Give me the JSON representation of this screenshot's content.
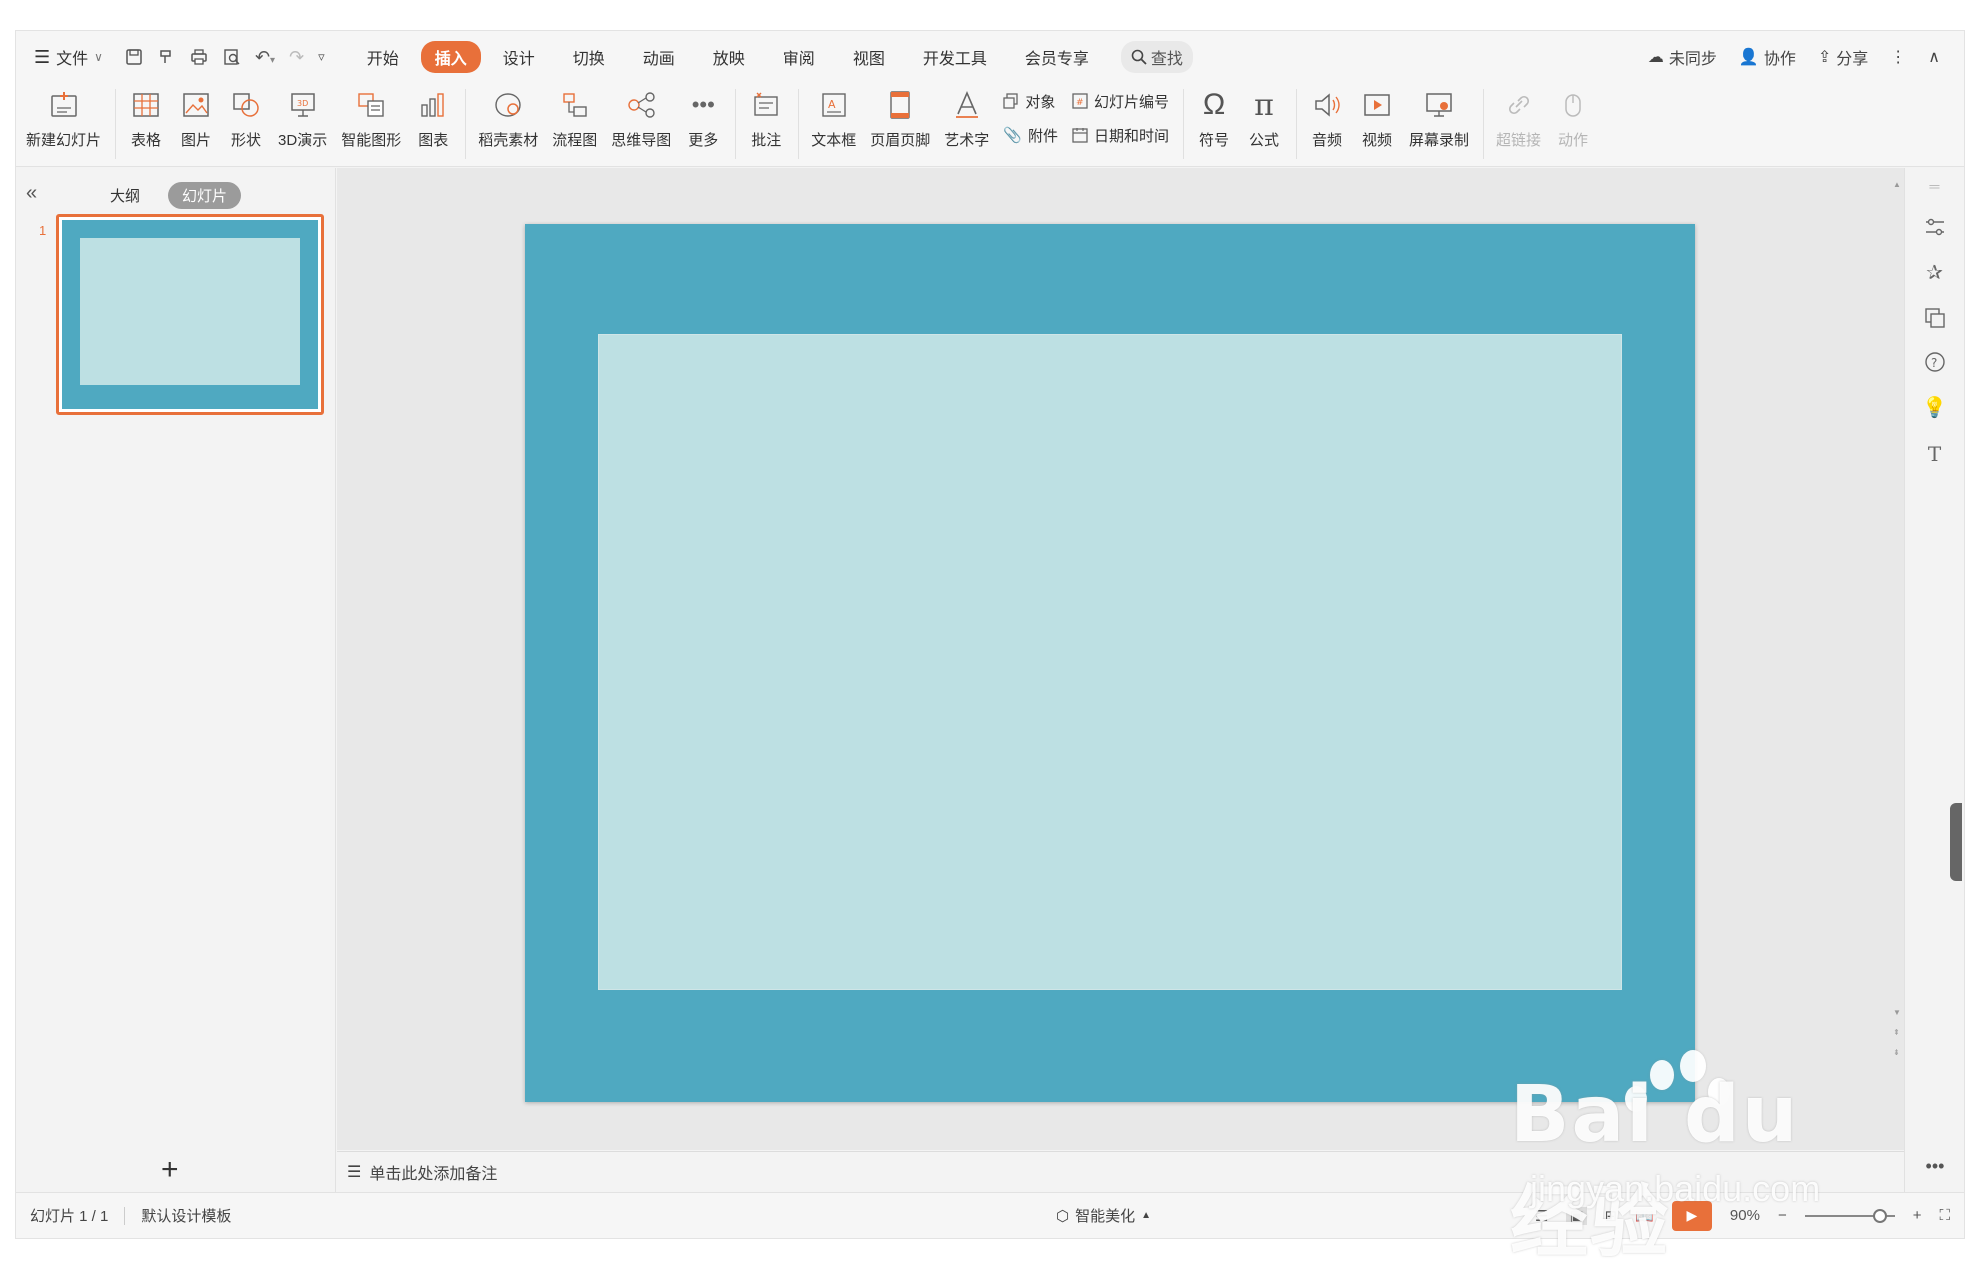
{
  "menubar": {
    "file_label": "文件",
    "tabs": [
      {
        "label": "开始"
      },
      {
        "label": "插入"
      },
      {
        "label": "设计"
      },
      {
        "label": "切换"
      },
      {
        "label": "动画"
      },
      {
        "label": "放映"
      },
      {
        "label": "审阅"
      },
      {
        "label": "视图"
      },
      {
        "label": "开发工具"
      },
      {
        "label": "会员专享"
      }
    ],
    "active_tab": "插入",
    "search_label": "查找",
    "sync_label": "未同步",
    "collab_label": "协作",
    "share_label": "分享"
  },
  "ribbon": {
    "new_slide": "新建幻灯片",
    "table": "表格",
    "picture": "图片",
    "shape": "形状",
    "demo3d": "3D演示",
    "smartart": "智能图形",
    "chart": "图表",
    "docer": "稻壳素材",
    "flowchart": "流程图",
    "mindmap": "思维导图",
    "more": "更多",
    "comment": "批注",
    "textbox": "文本框",
    "header_footer": "页眉页脚",
    "wordart": "艺术字",
    "object": "对象",
    "attachment": "附件",
    "slide_number": "幻灯片编号",
    "datetime": "日期和时间",
    "symbol": "符号",
    "formula": "公式",
    "audio": "音频",
    "video": "视频",
    "screen_record": "屏幕录制",
    "hyperlink": "超链接",
    "action": "动作"
  },
  "left_panel": {
    "outline_tab": "大纲",
    "slides_tab": "幻灯片",
    "slide_number": "1"
  },
  "notes": {
    "placeholder": "单击此处添加备注"
  },
  "statusbar": {
    "slide_count": "幻灯片 1 / 1",
    "template": "默认设计模板",
    "beautify": "智能美化",
    "zoom": "90%"
  },
  "colors": {
    "accent": "#e8703a",
    "slide_outer": "#4fa9c1",
    "slide_inner": "#bde0e3"
  },
  "watermark": {
    "logo": "Bai du 经验",
    "url": "jingyan.baidu.com"
  }
}
